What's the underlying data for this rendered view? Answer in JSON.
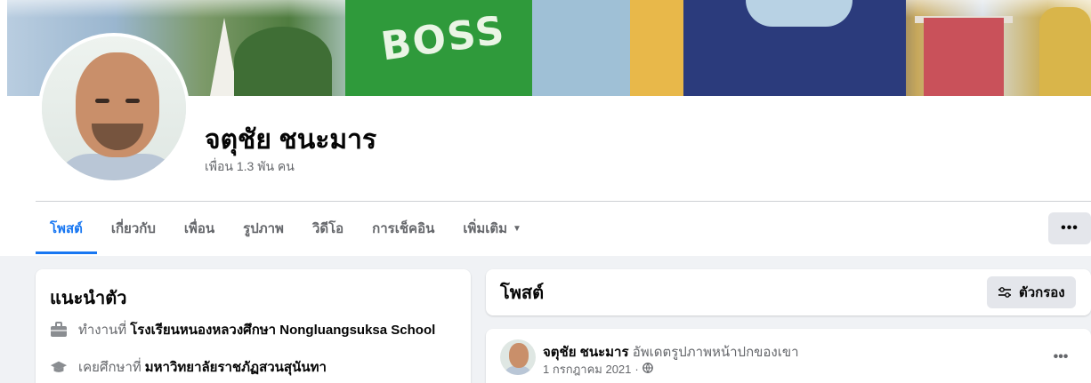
{
  "profile": {
    "name": "จตุชัย ชนะมาร",
    "friends": "เพื่อน 1.3 พัน คน",
    "cover_text": "BOSS"
  },
  "tabs": [
    {
      "label": "โพสต์"
    },
    {
      "label": "เกี่ยวกับ"
    },
    {
      "label": "เพื่อน"
    },
    {
      "label": "รูปภาพ"
    },
    {
      "label": "วิดีโอ"
    },
    {
      "label": "การเช็คอิน"
    },
    {
      "label": "เพิ่มเติม"
    }
  ],
  "more_button": "•••",
  "intro": {
    "title": "แนะนำตัว",
    "rows": [
      {
        "prefix": "ทำงานที่",
        "value": "โรงเรียนหนองหลวงศึกษา Nongluangsuksa School"
      },
      {
        "prefix": "เคยศึกษาที่",
        "value": "มหาวิทยาลัยราชภัฏสวนสุนันทา"
      }
    ]
  },
  "posts": {
    "title": "โพสต์",
    "filter_label": "ตัวกรอง"
  },
  "post": {
    "author": "จตุชัย ชนะมาร",
    "action": "อัพเดตรูปภาพหน้าปกของเขา",
    "date": "1 กรกฎาคม 2021",
    "separator": "·",
    "more": "•••"
  },
  "colors": {
    "accent": "#1877f2",
    "muted": "#65676b",
    "background": "#f0f2f5"
  }
}
